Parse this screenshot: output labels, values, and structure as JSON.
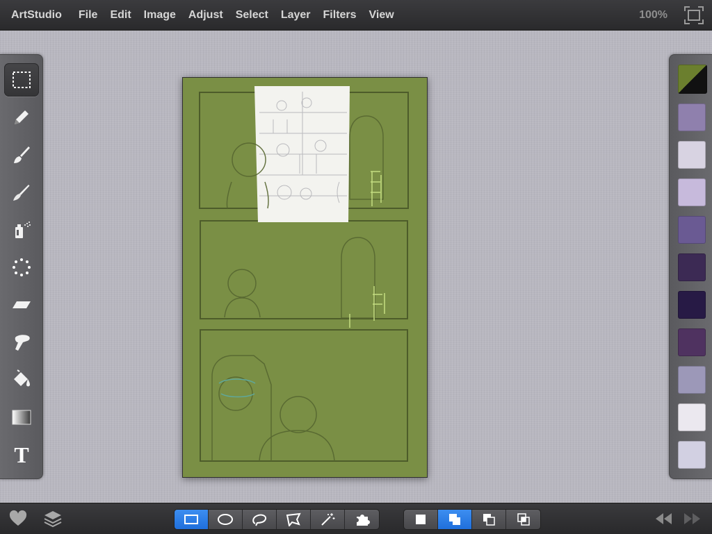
{
  "menubar": {
    "app_name": "ArtStudio",
    "menus": [
      "File",
      "Edit",
      "Image",
      "Adjust",
      "Select",
      "Layer",
      "Filters",
      "View"
    ],
    "zoom": "100%"
  },
  "tools": [
    "selection",
    "pencil",
    "brush",
    "smudge",
    "spray",
    "stamp-dots",
    "eraser",
    "smudge-finger",
    "bucket",
    "gradient",
    "text"
  ],
  "tool_text_glyph": "T",
  "active_tool": "selection",
  "colors": {
    "current_fg": "#6b7f2e",
    "current_bg": "#111111",
    "swatches": [
      "#8f80ad",
      "#d8d3e2",
      "#c7badc",
      "#6a5a93",
      "#3c2a54",
      "#271a45",
      "#4f3260",
      "#9c98b8",
      "#ebe8ef",
      "#d2d0e2"
    ],
    "canvas_bg": "#7a8f45",
    "accent": "#2a7be8"
  },
  "bottombar": {
    "selection_modes": [
      "rectangle",
      "ellipse",
      "lasso",
      "polygon",
      "magic-wand",
      "puzzle"
    ],
    "active_selection_mode": "rectangle",
    "combine_modes": [
      "new",
      "add",
      "subtract",
      "intersect"
    ],
    "active_combine_mode": "add"
  }
}
